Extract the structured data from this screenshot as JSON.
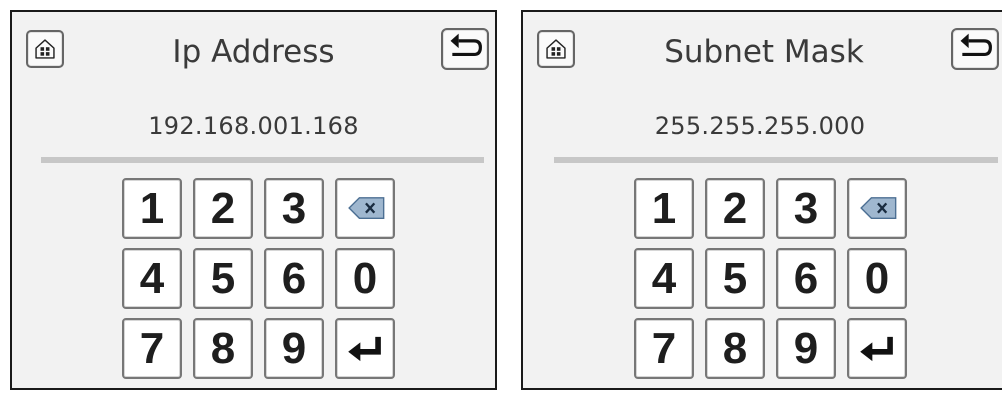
{
  "panels": [
    {
      "title": "Ip Address",
      "value": "192.168.001.168",
      "keys": [
        "1",
        "2",
        "3",
        "backspace",
        "4",
        "5",
        "6",
        "0",
        "7",
        "8",
        "9",
        "enter"
      ]
    },
    {
      "title": "Subnet Mask",
      "value": "255.255.255.000",
      "keys": [
        "1",
        "2",
        "3",
        "backspace",
        "4",
        "5",
        "6",
        "0",
        "7",
        "8",
        "9",
        "enter"
      ]
    }
  ],
  "icons": {
    "home": "home-icon",
    "back": "back-arrow-icon",
    "backspace": "backspace-x-icon",
    "enter": "enter-return-icon"
  },
  "colors": {
    "panel_bg": "#f2f2f2",
    "border": "#1a1a1a",
    "text": "#3a3a3a",
    "divider": "#c7c7c7",
    "backspace_fill": "#9fb7cf"
  }
}
